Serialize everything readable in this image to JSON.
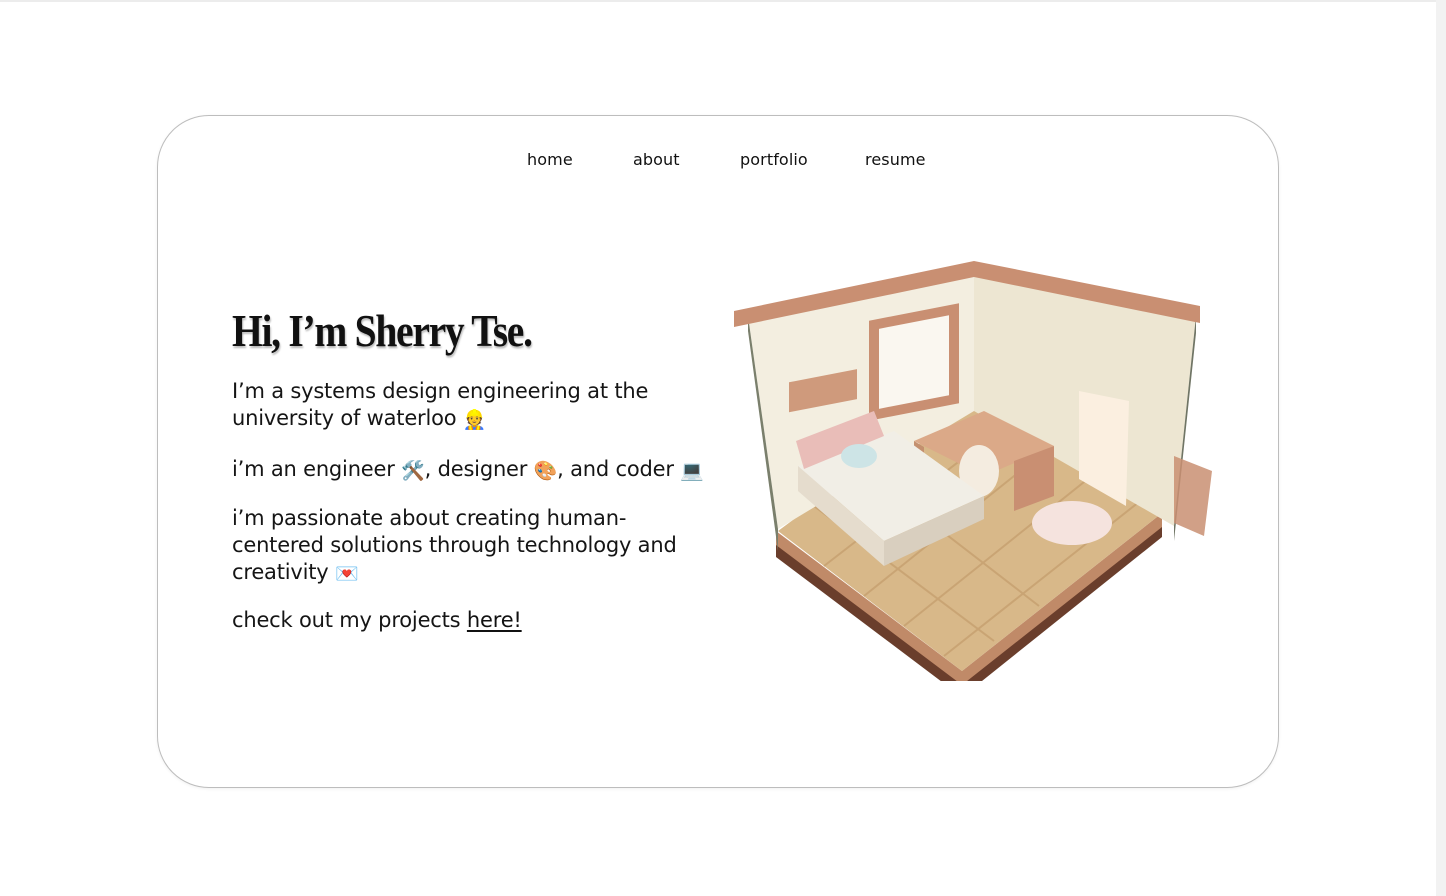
{
  "nav": {
    "items": [
      {
        "label": "home"
      },
      {
        "label": "about"
      },
      {
        "label": "portfolio"
      },
      {
        "label": "resume"
      }
    ]
  },
  "hero": {
    "heading": "Hi, I’m Sherry Tse.",
    "line1_text": "I’m a systems design engineering at the university of waterloo",
    "line1_emoji": "👷",
    "line2_part1": "i’m an engineer",
    "line2_emoji1": "🛠️",
    "line2_part2": ", designer",
    "line2_emoji2": "🎨",
    "line2_part3": ", and coder",
    "line2_emoji3": "💻",
    "line3_text": "i’m passionate about creating human-centered solutions through technology and creativity",
    "line3_emoji": "💌",
    "line4_text": "check out my projects",
    "line4_link": "here!"
  },
  "image": {
    "subject": "isometric bedroom illustration",
    "colors": {
      "wall": "#f3eee0",
      "trim": "#c98f72",
      "floor": "#d9b98a",
      "base": "#6a3e2c"
    }
  }
}
